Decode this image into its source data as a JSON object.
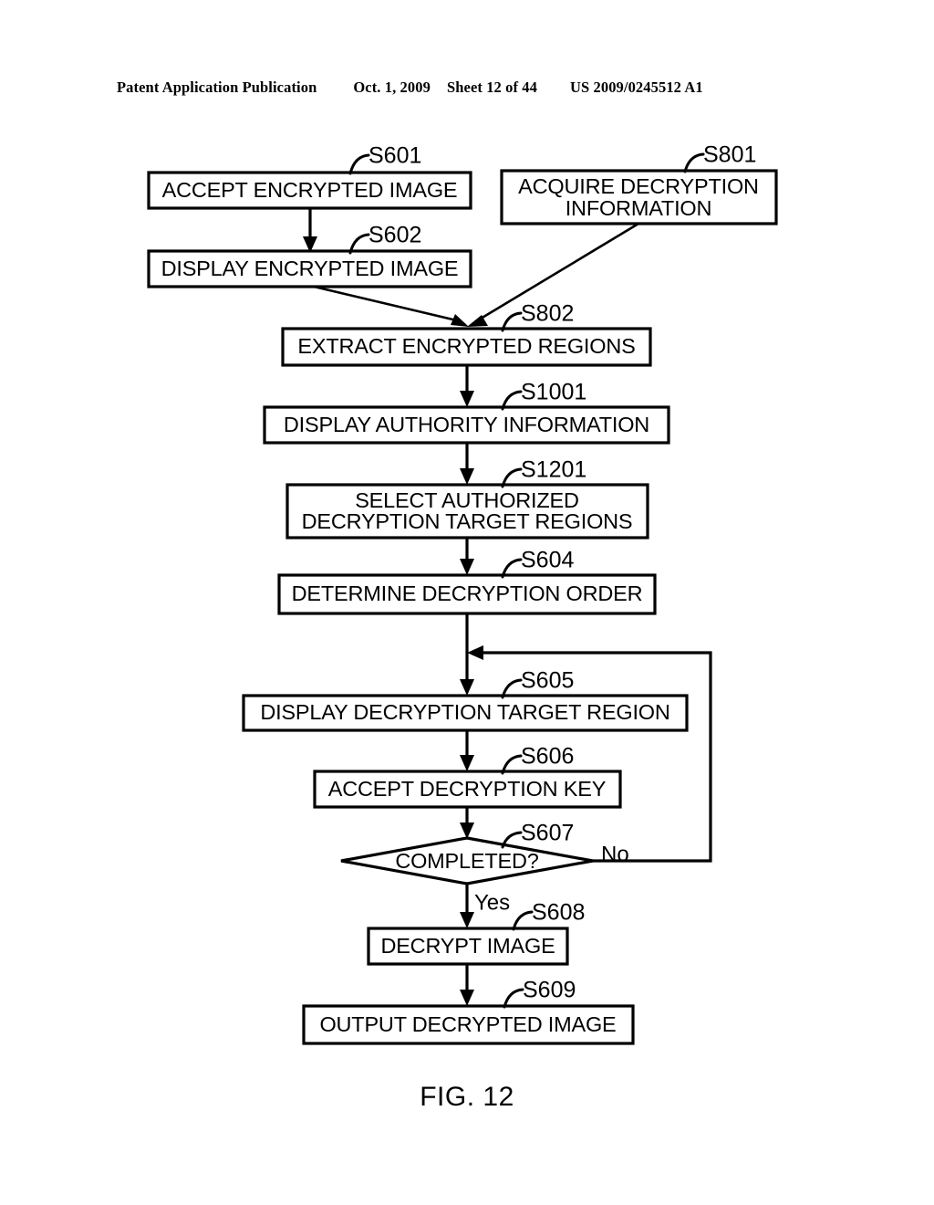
{
  "header": {
    "publication": "Patent Application Publication",
    "date": "Oct. 1, 2009",
    "sheet": "Sheet 12 of 44",
    "patent_number": "US 2009/0245512 A1"
  },
  "figure": {
    "caption": "FIG. 12"
  },
  "flowchart": {
    "nodes": [
      {
        "id": "S601",
        "ref": "S601",
        "shape": "process",
        "lines": [
          "ACCEPT ENCRYPTED IMAGE"
        ]
      },
      {
        "id": "S801",
        "ref": "S801",
        "shape": "process",
        "lines": [
          "ACQUIRE DECRYPTION",
          "INFORMATION"
        ]
      },
      {
        "id": "S602",
        "ref": "S602",
        "shape": "process",
        "lines": [
          "DISPLAY ENCRYPTED IMAGE"
        ]
      },
      {
        "id": "S802",
        "ref": "S802",
        "shape": "process",
        "lines": [
          "EXTRACT ENCRYPTED REGIONS"
        ]
      },
      {
        "id": "S1001",
        "ref": "S1001",
        "shape": "process",
        "lines": [
          "DISPLAY AUTHORITY INFORMATION"
        ]
      },
      {
        "id": "S1201",
        "ref": "S1201",
        "shape": "process",
        "lines": [
          "SELECT AUTHORIZED",
          "DECRYPTION TARGET REGIONS"
        ]
      },
      {
        "id": "S604",
        "ref": "S604",
        "shape": "process",
        "lines": [
          "DETERMINE DECRYPTION ORDER"
        ]
      },
      {
        "id": "S605",
        "ref": "S605",
        "shape": "process",
        "lines": [
          "DISPLAY DECRYPTION TARGET REGION"
        ]
      },
      {
        "id": "S606",
        "ref": "S606",
        "shape": "process",
        "lines": [
          "ACCEPT DECRYPTION KEY"
        ]
      },
      {
        "id": "S607",
        "ref": "S607",
        "shape": "decision",
        "lines": [
          "COMPLETED?"
        ]
      },
      {
        "id": "S608",
        "ref": "S608",
        "shape": "process",
        "lines": [
          "DECRYPT IMAGE"
        ]
      },
      {
        "id": "S609",
        "ref": "S609",
        "shape": "process",
        "lines": [
          "OUTPUT DECRYPTED IMAGE"
        ]
      }
    ],
    "branch_labels": {
      "no": "No",
      "yes": "Yes"
    }
  }
}
